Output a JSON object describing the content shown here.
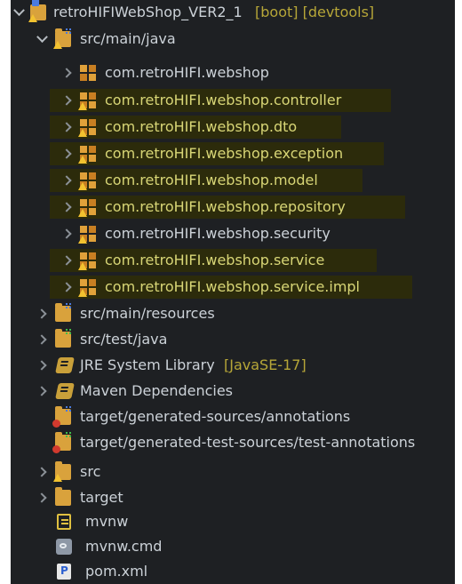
{
  "tree": {
    "project": {
      "name": "retroHIFIWebShop_VER2_1",
      "decoration": "[boot] [devtools]"
    },
    "items": [
      {
        "label": "src/main/java",
        "icon": "source-folder-warning-icon"
      },
      {
        "label": "com.retroHIFI.webshop",
        "icon": "package-icon"
      },
      {
        "label": "com.retroHIFI.webshop.controller",
        "icon": "package-warning-icon"
      },
      {
        "label": "com.retroHIFI.webshop.dto",
        "icon": "package-warning-icon"
      },
      {
        "label": "com.retroHIFI.webshop.exception",
        "icon": "package-warning-icon"
      },
      {
        "label": "com.retroHIFI.webshop.model",
        "icon": "package-warning-icon"
      },
      {
        "label": "com.retroHIFI.webshop.repository",
        "icon": "package-warning-icon"
      },
      {
        "label": "com.retroHIFI.webshop.security",
        "icon": "package-warning-icon"
      },
      {
        "label": "com.retroHIFI.webshop.service",
        "icon": "package-warning-icon"
      },
      {
        "label": "com.retroHIFI.webshop.service.impl",
        "icon": "package-warning-icon"
      },
      {
        "label": "src/main/resources",
        "icon": "source-folder-icon"
      },
      {
        "label": "src/test/java",
        "icon": "test-source-folder-icon"
      },
      {
        "label": "JRE System Library",
        "decoration": "[JavaSE-17]",
        "icon": "library-icon"
      },
      {
        "label": "Maven Dependencies",
        "icon": "library-icon"
      },
      {
        "label": "target/generated-sources/annotations",
        "icon": "source-folder-error-icon"
      },
      {
        "label": "target/generated-test-sources/test-annotations",
        "icon": "test-source-folder-error-icon"
      },
      {
        "label": "src",
        "icon": "folder-warning-icon"
      },
      {
        "label": "target",
        "icon": "folder-icon"
      },
      {
        "label": "mvnw",
        "icon": "text-file-icon"
      },
      {
        "label": "mvnw.cmd",
        "icon": "cmd-file-icon"
      },
      {
        "label": "pom.xml",
        "icon": "pom-file-icon"
      }
    ]
  },
  "colors": {
    "background": "#1e2023",
    "text": "#ccd2d8",
    "highlight": "#2c2b0b",
    "decoration": "#b6a638"
  }
}
